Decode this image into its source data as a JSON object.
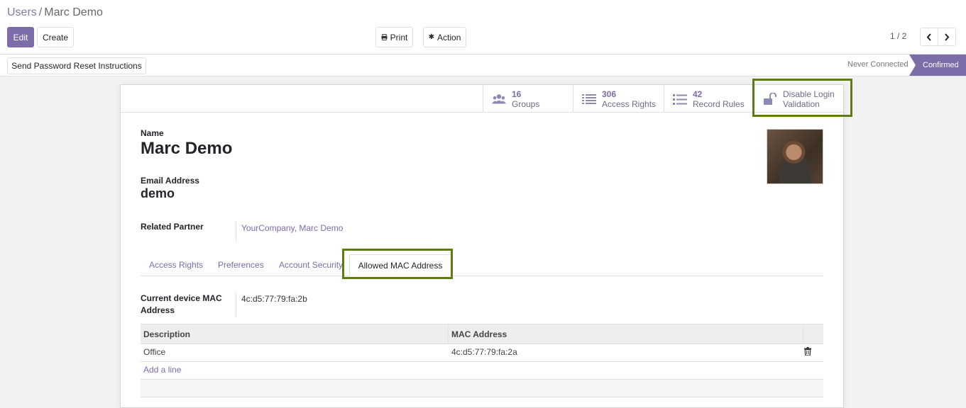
{
  "breadcrumb": {
    "parent": "Users",
    "separator": "/",
    "current": "Marc Demo"
  },
  "toolbar": {
    "edit_label": "Edit",
    "create_label": "Create",
    "print_label": "Print",
    "action_label": "Action"
  },
  "pager": {
    "value": "1 / 2"
  },
  "statusbar": {
    "reset_button_label": "Send Password Reset Instructions",
    "states": [
      "Never Connected",
      "Confirmed"
    ],
    "active_state": "Confirmed"
  },
  "smart_buttons": [
    {
      "value": "16",
      "label": "Groups",
      "icon": "users-icon"
    },
    {
      "value": "306",
      "label": "Access Rights",
      "icon": "list-icon"
    },
    {
      "value": "42",
      "label": "Record Rules",
      "icon": "list-icon"
    },
    {
      "line1": "Disable Login",
      "line2": "Validation",
      "icon": "unlock-icon"
    }
  ],
  "form": {
    "name_label": "Name",
    "name_value": "Marc Demo",
    "email_label": "Email Address",
    "email_value": "demo",
    "partner_label": "Related Partner",
    "partner_value": "YourCompany, Marc Demo"
  },
  "tabs": [
    {
      "label": "Access Rights"
    },
    {
      "label": "Preferences"
    },
    {
      "label": "Account Security"
    },
    {
      "label": "Allowed MAC Address",
      "active": true
    }
  ],
  "mac": {
    "current_label": "Current device MAC Address",
    "current_value": "4c:d5:77:79:fa:2b",
    "table": {
      "columns": [
        "Description",
        "MAC Address"
      ],
      "rows": [
        {
          "description": "Office",
          "mac": "4c:d5:77:79:fa:2a"
        }
      ],
      "add_line_label": "Add a line"
    }
  },
  "colors": {
    "primary": "#7c6ca8",
    "highlight": "#5f7c12"
  }
}
